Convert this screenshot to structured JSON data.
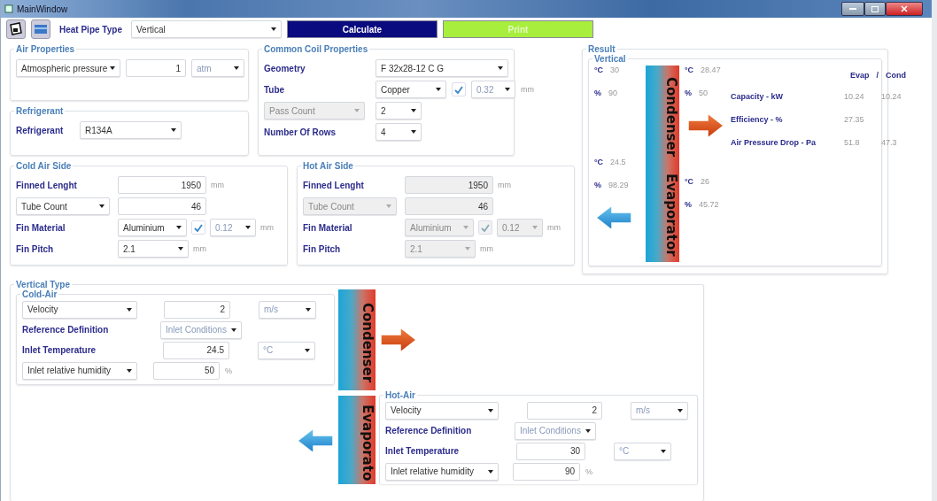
{
  "window": {
    "title": "MainWindow"
  },
  "toolbar": {
    "label": "Heat Pipe Type",
    "type_select": "Vertical",
    "buttons": [
      {
        "label": "Calculate",
        "kind": "primary"
      },
      {
        "label": "Print",
        "kind": "secondary"
      }
    ]
  },
  "air_properties": {
    "title": "Air Properties",
    "selector": "Atmospheric pressure",
    "value": "1",
    "unit": "atm"
  },
  "refrigerant": {
    "title": "Refrigerant",
    "label": "Refrigerant",
    "value": "R134A"
  },
  "common_coil": {
    "title": "Common Coil Properties",
    "geometry": {
      "label": "Geometry",
      "value": "F 32x28-12 C G"
    },
    "tube": {
      "label": "Tube",
      "material": "Copper",
      "checked": true,
      "thickness": "0.32",
      "unit": "mm"
    },
    "pass_count": {
      "selector": "Pass Count",
      "disabled": true,
      "value": "2"
    },
    "rows": {
      "label": "Number Of Rows",
      "value": "4"
    }
  },
  "cold_air_side": {
    "title": "Cold Air Side",
    "disabled": false,
    "finned_length": {
      "label": "Finned Lenght",
      "value": "1950",
      "unit": "mm"
    },
    "tube_count": {
      "selector": "Tube Count",
      "value": "46"
    },
    "fin_material": {
      "label": "Fin Material",
      "material": "Aluminium",
      "checked": true,
      "thickness": "0.12",
      "unit": "mm"
    },
    "fin_pitch": {
      "label": "Fin Pitch",
      "value": "2.1",
      "unit": "mm"
    }
  },
  "hot_air_side": {
    "title": "Hot Air Side",
    "disabled": true,
    "finned_length": {
      "label": "Finned Lenght",
      "value": "1950",
      "unit": "mm"
    },
    "tube_count": {
      "selector": "Tube Count",
      "value": "46"
    },
    "fin_material": {
      "label": "Fin Material",
      "material": "Aluminium",
      "checked": true,
      "thickness": "0.12",
      "unit": "mm"
    },
    "fin_pitch": {
      "label": "Fin Pitch",
      "value": "2.1",
      "unit": "mm"
    }
  },
  "result": {
    "title": "Result",
    "group": "Vertical",
    "condenser": {
      "label": "Condenser",
      "inlet": [
        {
          "unit": "°C",
          "value": "30"
        },
        {
          "unit": "%",
          "value": "90"
        }
      ],
      "outlet": [
        {
          "unit": "°C",
          "value": "28.47"
        },
        {
          "unit": "%",
          "value": "50"
        }
      ]
    },
    "evaporator": {
      "label": "Evaporator",
      "inlet": [
        {
          "unit": "°C",
          "value": "24.5"
        },
        {
          "unit": "%",
          "value": "98.29"
        }
      ],
      "outlet": [
        {
          "unit": "°C",
          "value": "26"
        },
        {
          "unit": "%",
          "value": "45.72"
        }
      ]
    },
    "table": {
      "headers": [
        "Evap",
        "/",
        "Cond"
      ],
      "rows": [
        {
          "label": "Capacity - kW",
          "evap": "10.24",
          "cond": "10.24"
        },
        {
          "label": "Efficiency - %",
          "evap": "27.35"
        },
        {
          "label": "Air Pressure Drop - Pa",
          "evap": "51.8",
          "cond": "47.3"
        }
      ]
    }
  },
  "vertical_type": {
    "title": "Vertical Type",
    "condenser_label": "Condenser",
    "evaporator_label": "Evaporato",
    "cold_air": {
      "title": "Cold-Air",
      "flow": {
        "selector": "Velocity",
        "value": "2",
        "unit": "m/s"
      },
      "reference": {
        "label": "Reference Definition",
        "value": "Inlet Conditions"
      },
      "temperature": {
        "label": "Inlet Temperature",
        "value": "24.5",
        "unit": "°C"
      },
      "humidity": {
        "selector": "Inlet relative humidity",
        "value": "50",
        "unit": "%"
      }
    },
    "hot_air": {
      "title": "Hot-Air",
      "flow": {
        "selector": "Velocity",
        "value": "2",
        "unit": "m/s"
      },
      "reference": {
        "label": "Reference Definition",
        "value": "Inlet Conditions"
      },
      "temperature": {
        "label": "Inlet Temperature",
        "value": "30",
        "unit": "°C"
      },
      "humidity": {
        "selector": "Inlet relative humidity",
        "value": "90",
        "unit": "%"
      }
    }
  }
}
